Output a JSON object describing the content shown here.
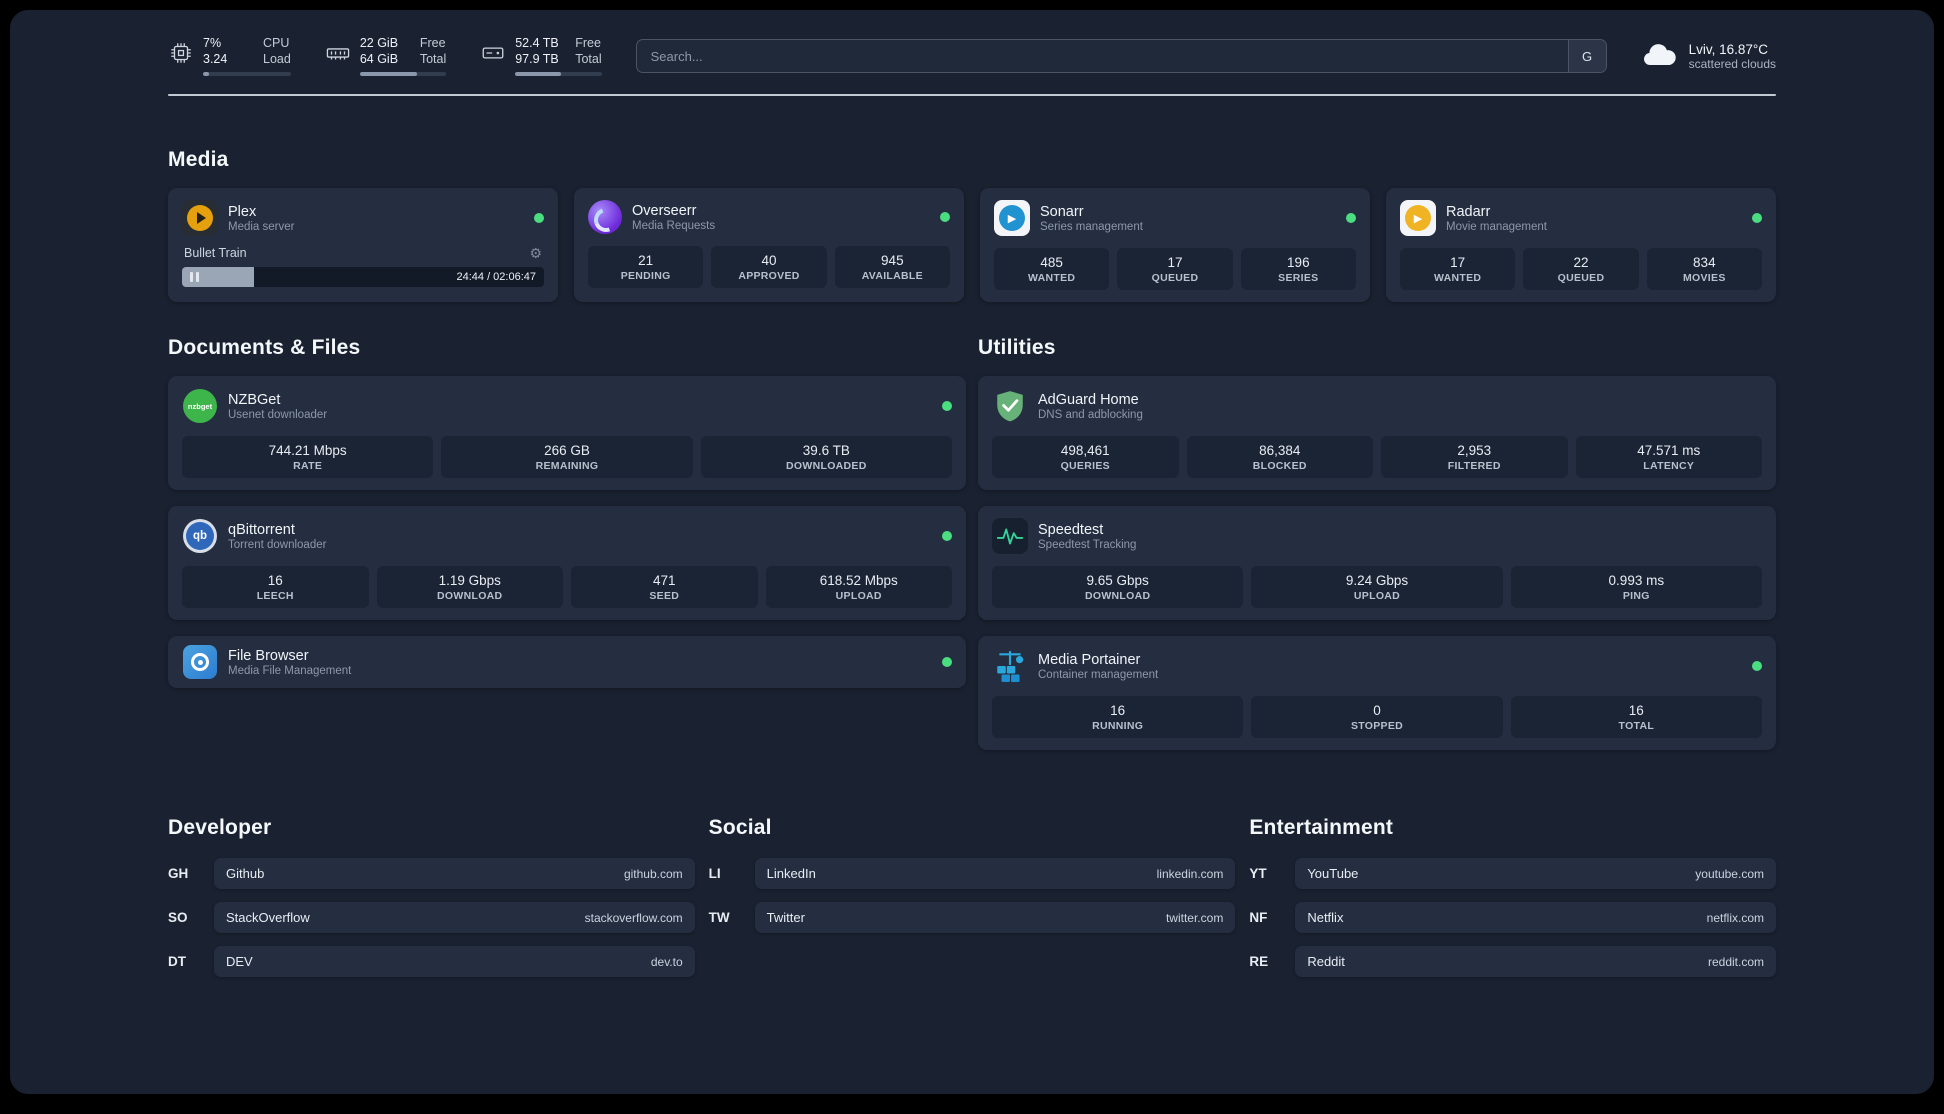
{
  "theme": {
    "background": "#1a2231",
    "card": "#242e40",
    "stat_box": "#1b2434",
    "status_green": "#4ade80",
    "divider": "#d4dbe5"
  },
  "icons": {
    "gear": "⚙",
    "play": "▶",
    "qb": "qb",
    "nzbget": "nzbget"
  },
  "topbar": {
    "cpu": {
      "value_top": "7%",
      "value_bottom": "3.24",
      "label_top": "CPU",
      "label_bottom": "Load",
      "bar_pct": 7
    },
    "ram": {
      "value_top": "22 GiB",
      "value_bottom": "64 GiB",
      "label_top": "Free",
      "label_bottom": "Total",
      "bar_pct": 66
    },
    "disk": {
      "value_top": "52.4 TB",
      "value_bottom": "97.9 TB",
      "label_top": "Free",
      "label_bottom": "Total",
      "bar_pct": 53
    },
    "search": {
      "placeholder": "Search...",
      "button": "G"
    },
    "weather": {
      "location": "Lviv, 16.87°C",
      "condition": "scattered clouds"
    }
  },
  "sections": {
    "media": {
      "title": "Media"
    },
    "documents": {
      "title": "Documents & Files"
    },
    "utilities": {
      "title": "Utilities"
    },
    "developer": {
      "title": "Developer"
    },
    "social": {
      "title": "Social"
    },
    "entertainment": {
      "title": "Entertainment"
    }
  },
  "apps": {
    "plex": {
      "name": "Plex",
      "desc": "Media server",
      "now_playing": "Bullet Train",
      "time": "24:44 / 02:06:47",
      "progress_pct": 20
    },
    "overseerr": {
      "name": "Overseerr",
      "desc": "Media Requests",
      "stats": [
        {
          "value": "21",
          "label": "PENDING"
        },
        {
          "value": "40",
          "label": "APPROVED"
        },
        {
          "value": "945",
          "label": "AVAILABLE"
        }
      ]
    },
    "sonarr": {
      "name": "Sonarr",
      "desc": "Series management",
      "stats": [
        {
          "value": "485",
          "label": "WANTED"
        },
        {
          "value": "17",
          "label": "QUEUED"
        },
        {
          "value": "196",
          "label": "SERIES"
        }
      ]
    },
    "radarr": {
      "name": "Radarr",
      "desc": "Movie management",
      "stats": [
        {
          "value": "17",
          "label": "WANTED"
        },
        {
          "value": "22",
          "label": "QUEUED"
        },
        {
          "value": "834",
          "label": "MOVIES"
        }
      ]
    },
    "nzbget": {
      "name": "NZBGet",
      "desc": "Usenet downloader",
      "stats": [
        {
          "value": "744.21 Mbps",
          "label": "RATE"
        },
        {
          "value": "266 GB",
          "label": "REMAINING"
        },
        {
          "value": "39.6 TB",
          "label": "DOWNLOADED"
        }
      ]
    },
    "qbittorrent": {
      "name": "qBittorrent",
      "desc": "Torrent downloader",
      "stats": [
        {
          "value": "16",
          "label": "LEECH"
        },
        {
          "value": "1.19 Gbps",
          "label": "DOWNLOAD"
        },
        {
          "value": "471",
          "label": "SEED"
        },
        {
          "value": "618.52 Mbps",
          "label": "UPLOAD"
        }
      ]
    },
    "filebrowser": {
      "name": "File Browser",
      "desc": "Media File Management"
    },
    "adguard": {
      "name": "AdGuard Home",
      "desc": "DNS and adblocking",
      "stats": [
        {
          "value": "498,461",
          "label": "QUERIES"
        },
        {
          "value": "86,384",
          "label": "BLOCKED"
        },
        {
          "value": "2,953",
          "label": "FILTERED"
        },
        {
          "value": "47.571 ms",
          "label": "LATENCY"
        }
      ]
    },
    "speedtest": {
      "name": "Speedtest",
      "desc": "Speedtest Tracking",
      "stats": [
        {
          "value": "9.65 Gbps",
          "label": "DOWNLOAD"
        },
        {
          "value": "9.24 Gbps",
          "label": "UPLOAD"
        },
        {
          "value": "0.993 ms",
          "label": "PING"
        }
      ]
    },
    "portainer": {
      "name": "Media Portainer",
      "desc": "Container management",
      "stats": [
        {
          "value": "16",
          "label": "RUNNING"
        },
        {
          "value": "0",
          "label": "STOPPED"
        },
        {
          "value": "16",
          "label": "TOTAL"
        }
      ]
    }
  },
  "bookmarks": {
    "developer": [
      {
        "abbr": "GH",
        "name": "Github",
        "url": "github.com"
      },
      {
        "abbr": "SO",
        "name": "StackOverflow",
        "url": "stackoverflow.com"
      },
      {
        "abbr": "DT",
        "name": "DEV",
        "url": "dev.to"
      }
    ],
    "social": [
      {
        "abbr": "LI",
        "name": "LinkedIn",
        "url": "linkedin.com"
      },
      {
        "abbr": "TW",
        "name": "Twitter",
        "url": "twitter.com"
      }
    ],
    "entertainment": [
      {
        "abbr": "YT",
        "name": "YouTube",
        "url": "youtube.com"
      },
      {
        "abbr": "NF",
        "name": "Netflix",
        "url": "netflix.com"
      },
      {
        "abbr": "RE",
        "name": "Reddit",
        "url": "reddit.com"
      }
    ]
  }
}
